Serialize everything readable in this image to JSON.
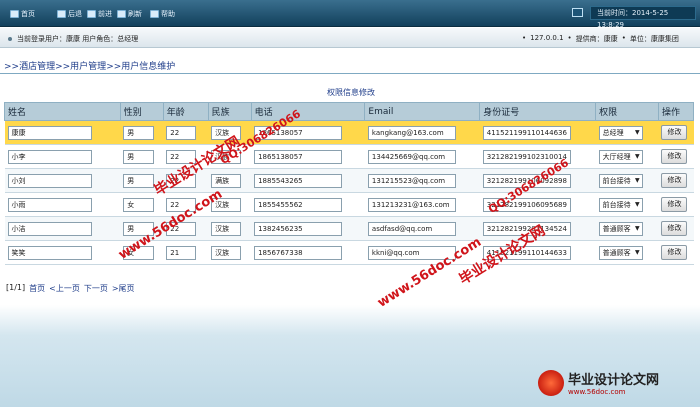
{
  "toolbar": {
    "buttons": [
      "首页",
      "后退",
      "前进",
      "刷新",
      "帮助"
    ],
    "time_label": "当前时间：2014-5-25 13:8:29"
  },
  "infobar": {
    "left": "当前登录用户：康康  用户角色：总经理",
    "ip": "127.0.0.1",
    "provider": "提供商：康康",
    "unit": "单位：康康集团"
  },
  "breadcrumb": [
    ">>酒店管理",
    ">>用户管理",
    ">>用户信息维护"
  ],
  "caption": "权限信息修改",
  "table": {
    "headers": [
      "姓名",
      "性别",
      "年龄",
      "民族",
      "电话",
      "Email",
      "身份证号",
      "权限",
      "操作"
    ],
    "rows": [
      {
        "name": "康康",
        "gender": "男",
        "age": "22",
        "nation": "汉族",
        "phone": "1865138057",
        "email": "kangkang@163.com",
        "id": "411521199110144636",
        "role": "总经理",
        "action": "修改"
      },
      {
        "name": "小李",
        "gender": "男",
        "age": "22",
        "nation": "汉族",
        "phone": "1865138057",
        "email": "134425669@qq.com",
        "id": "321282199102310014",
        "role": "大厅经理",
        "action": "修改"
      },
      {
        "name": "小刘",
        "gender": "男",
        "age": "22",
        "nation": "满族",
        "phone": "1885543265",
        "email": "131215523@qq.com",
        "id": "321282199106092898",
        "role": "前台接待",
        "action": "修改"
      },
      {
        "name": "小雨",
        "gender": "女",
        "age": "22",
        "nation": "汉族",
        "phone": "1855455562",
        "email": "131213231@163.com",
        "id": "321282199106095689",
        "role": "前台接待",
        "action": "修改"
      },
      {
        "name": "小洁",
        "gender": "男",
        "age": "22",
        "nation": "汉族",
        "phone": "1382456235",
        "email": "asdfasd@qq.com",
        "id": "321282199202134524",
        "role": "普通顾客",
        "action": "修改"
      },
      {
        "name": "笑笑",
        "gender": "女",
        "age": "21",
        "nation": "汉族",
        "phone": "1856767338",
        "email": "kkni@qq.com",
        "id": "411521199110144633",
        "role": "普通顾客",
        "action": "修改"
      }
    ]
  },
  "pager": {
    "info": "[1/1]",
    "first": "首页",
    "prev": "<上一页",
    "next": "下一页",
    "last": ">尾页"
  },
  "watermark": {
    "site_cn": "毕业设计论文网",
    "url": "www.56doc.com",
    "qq": "QQ:306826066"
  },
  "logo": {
    "title": "毕业设计论文网",
    "url": "www.56doc.com"
  },
  "colors": {
    "toolbar": "#12405c",
    "selected_row": "#ffd84a",
    "header_row": "#b6ccd8",
    "watermark": "#d0141a"
  }
}
